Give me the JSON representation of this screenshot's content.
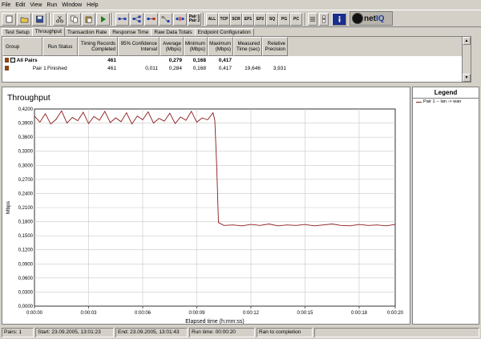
{
  "menu": [
    "File",
    "Edit",
    "View",
    "Run",
    "Window",
    "Help"
  ],
  "toolbar": {
    "pair_button": [
      "Pair 1",
      "Pair 2"
    ],
    "filter_buttons": [
      "ALL",
      "TCP",
      "SCR",
      "EP1",
      "EP2",
      "SQ",
      "PG",
      "PC"
    ],
    "logo_text": "net",
    "logo_suffix": "IQ"
  },
  "tabs": [
    "Test Setup",
    "Throughput",
    "Transaction Rate",
    "Response Time",
    "Raw Data Totals",
    "Endpoint Configuration"
  ],
  "active_tab": 1,
  "grid": {
    "headers": [
      "Group",
      "Run Status",
      "Timing Records Completed",
      "95% Confidence Interval",
      "Average (Mbps)",
      "Minimum (Mbps)",
      "Maximum (Mbps)",
      "Measured Time (sec)",
      "Relative Precision"
    ],
    "rows": [
      {
        "group": "All Pairs",
        "status": "",
        "records": "461",
        "confidence": "",
        "average": "0,279",
        "minimum": "0,168",
        "maximum": "0,417",
        "time": "",
        "precision": ""
      },
      {
        "group": "Pair 1",
        "status": "Finished",
        "records": "461",
        "confidence": "0,011",
        "average": "0,284",
        "minimum": "0,168",
        "maximum": "0,417",
        "time": "19,646",
        "precision": "3,931"
      }
    ]
  },
  "chart_data": {
    "type": "line",
    "title": "Throughput",
    "xlabel": "Elapsed time (h:mm:ss)",
    "ylabel": "Mbps",
    "x_ticks": [
      "0:00:00",
      "0:00:03",
      "0:00:06",
      "0:00:09",
      "0:00:12",
      "0:00:15",
      "0:00:18",
      "0:00:20"
    ],
    "y_ticks": [
      "0,0000",
      "0,0300",
      "0,0600",
      "0,0900",
      "0,1200",
      "0,1500",
      "0,1800",
      "0,2100",
      "0,2400",
      "0,2700",
      "0,3000",
      "0,3300",
      "0,3600",
      "0,3900",
      "0,4200"
    ],
    "xlim": [
      0,
      20
    ],
    "ylim": [
      0,
      0.42
    ],
    "grid": true,
    "series": [
      {
        "name": "Pair 1 -- lan -> wan",
        "color": "#8b1a1a",
        "x": [
          0,
          0.3,
          0.6,
          0.9,
          1.2,
          1.5,
          1.8,
          2.1,
          2.4,
          2.7,
          3.0,
          3.3,
          3.6,
          3.9,
          4.2,
          4.5,
          4.8,
          5.1,
          5.4,
          5.7,
          6.0,
          6.3,
          6.6,
          6.9,
          7.2,
          7.5,
          7.8,
          8.1,
          8.4,
          8.7,
          9.0,
          9.3,
          9.6,
          9.9,
          10.0,
          10.1,
          10.2,
          10.5,
          11.0,
          11.5,
          12.0,
          12.5,
          13.0,
          13.5,
          14.0,
          14.5,
          15.0,
          15.5,
          16.0,
          16.5,
          17.0,
          17.5,
          18.0,
          18.5,
          19.0,
          19.5,
          20.0
        ],
        "values": [
          0.405,
          0.392,
          0.41,
          0.388,
          0.398,
          0.416,
          0.39,
          0.402,
          0.395,
          0.413,
          0.389,
          0.404,
          0.396,
          0.415,
          0.391,
          0.401,
          0.393,
          0.412,
          0.388,
          0.405,
          0.397,
          0.414,
          0.39,
          0.4,
          0.394,
          0.411,
          0.389,
          0.403,
          0.396,
          0.415,
          0.392,
          0.401,
          0.397,
          0.412,
          0.395,
          0.3,
          0.178,
          0.172,
          0.173,
          0.171,
          0.174,
          0.172,
          0.175,
          0.171,
          0.173,
          0.172,
          0.174,
          0.171,
          0.173,
          0.175,
          0.172,
          0.171,
          0.174,
          0.172,
          0.173,
          0.171,
          0.174
        ]
      }
    ]
  },
  "status": {
    "pairs": "Pairs: 1",
    "start": "Start: 23.09.2005, 13:01:23",
    "end": "End: 23.09.2005, 13:01:43",
    "runtime": "Run time: 00:00:20",
    "result": "Ran to completion"
  }
}
